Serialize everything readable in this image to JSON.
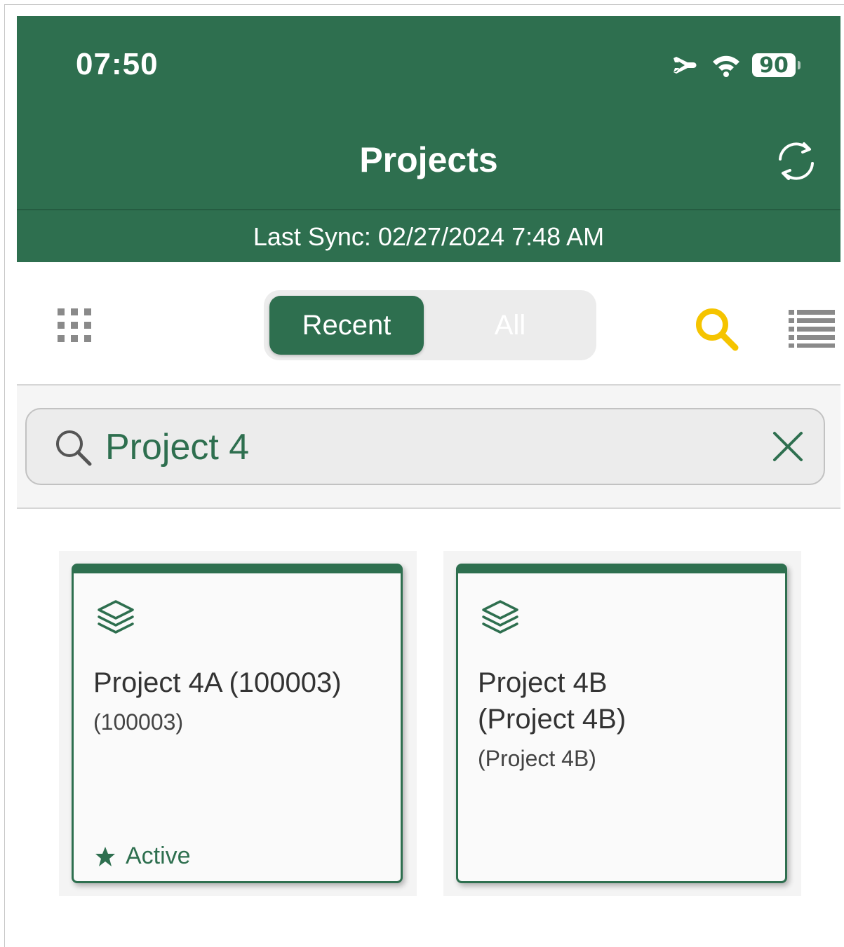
{
  "status_bar": {
    "time": "07:50",
    "battery": "90"
  },
  "header": {
    "title": "Projects",
    "last_sync": "Last Sync: 02/27/2024 7:48 AM"
  },
  "toolbar": {
    "segments": [
      {
        "label": "Recent",
        "selected": true
      },
      {
        "label": "All",
        "selected": false
      }
    ]
  },
  "search": {
    "value": "Project 4"
  },
  "projects": [
    {
      "title": "Project 4A (100003)",
      "subtitle": "(100003)",
      "status": "Active",
      "icon": "layers-icon"
    },
    {
      "title": "Project 4B (Project 4B)",
      "subtitle": "(Project 4B)",
      "status": "",
      "icon": "layers-icon"
    }
  ],
  "colors": {
    "brand_green": "#2e6f4f",
    "search_highlight": "#f5c400"
  }
}
